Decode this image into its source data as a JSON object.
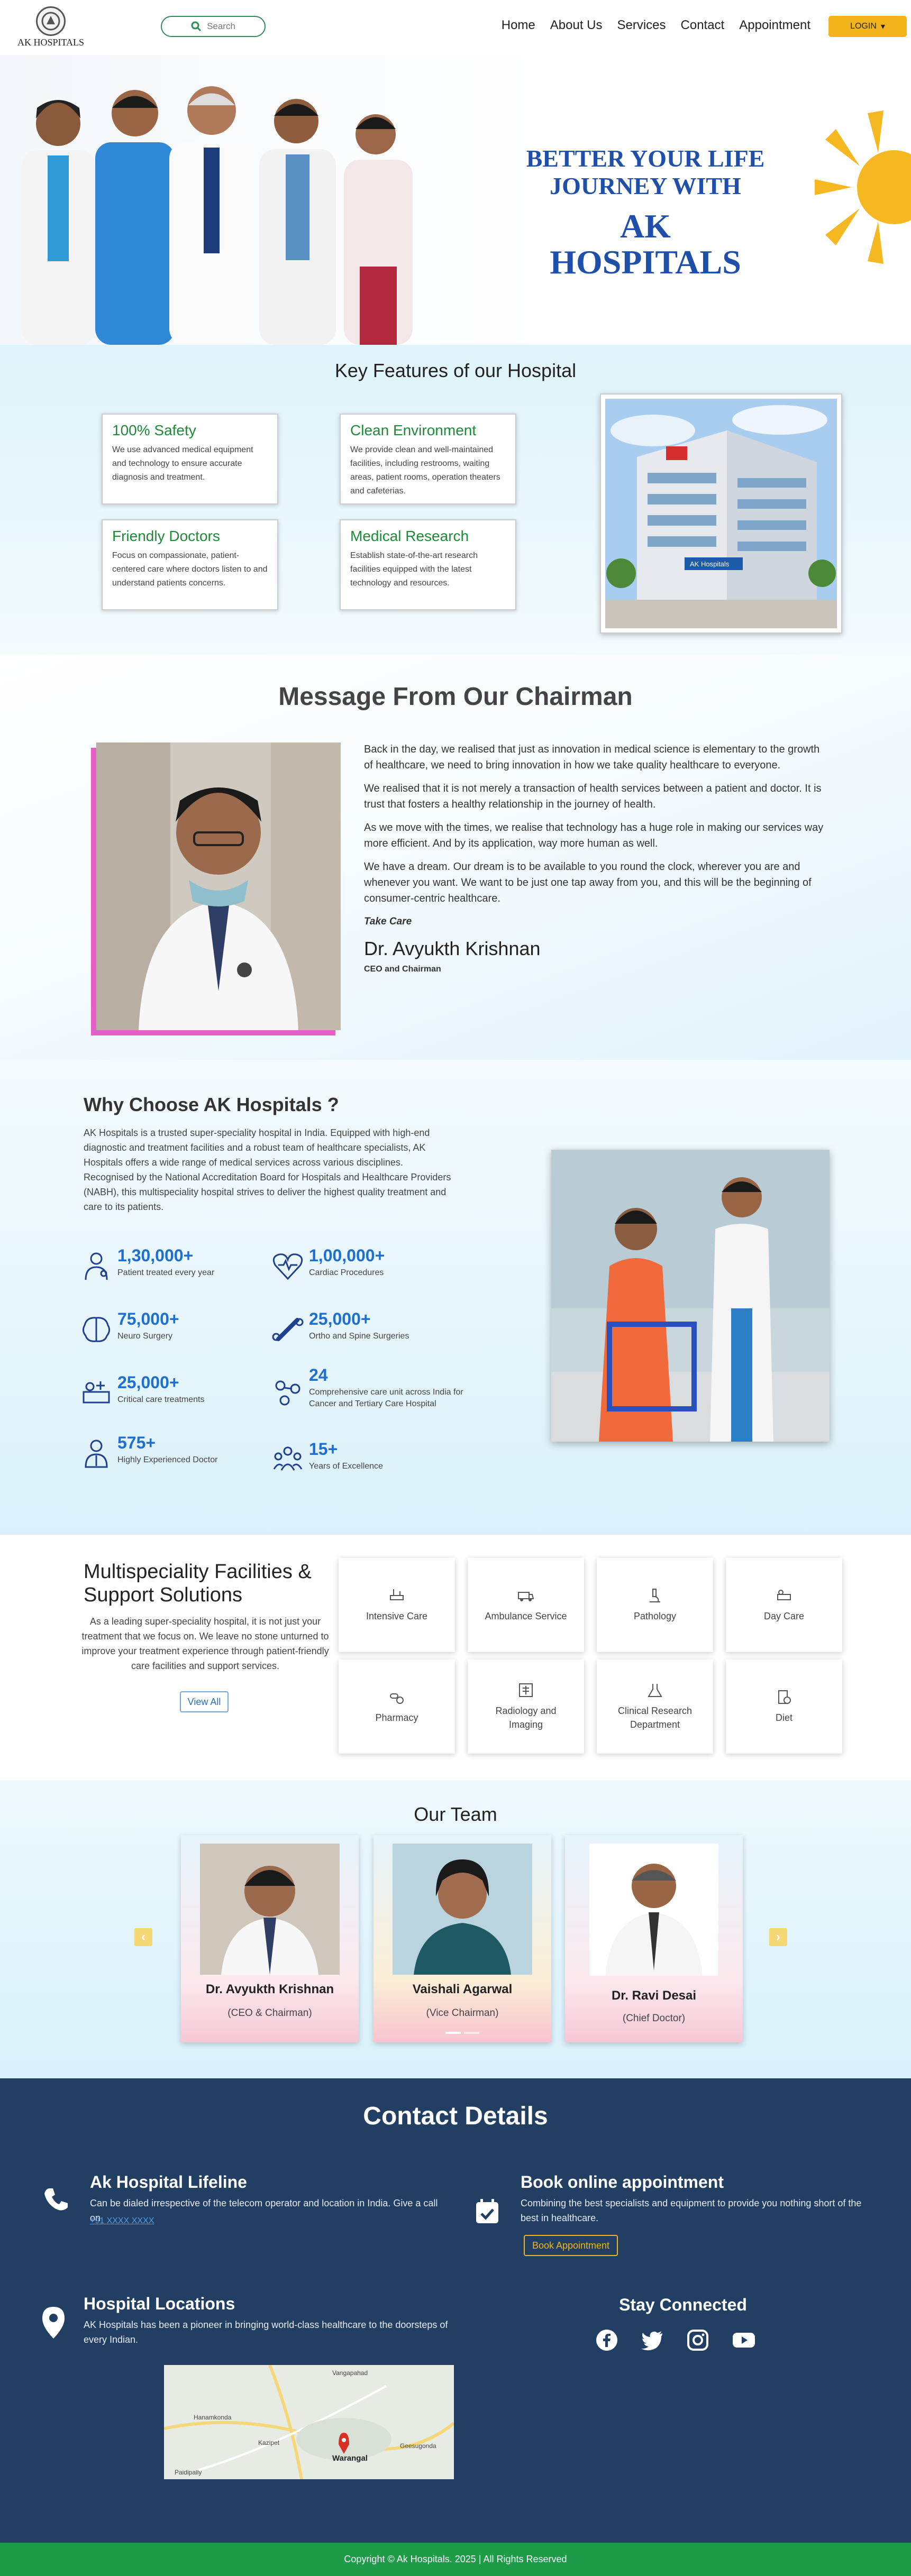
{
  "nav": {
    "logo_text": "AK HOSPITALS",
    "search_placeholder": "Search",
    "menu": [
      "Home",
      "About Us",
      "Services",
      "Contact",
      "Appointment"
    ],
    "login_label": "LOGIN"
  },
  "hero": {
    "line1": "BETTER YOUR LIFE",
    "line2": "JOURNEY WITH",
    "line3": "AK",
    "line4": "HOSPITALS"
  },
  "features": {
    "title": "Key Features of our Hospital",
    "cards": [
      {
        "title": "100% Safety",
        "text": "We use advanced medical equipment and technology to ensure accurate diagnosis and treatment."
      },
      {
        "title": "Clean Environment",
        "text": "We provide clean and well-maintained facilities, including restrooms, waiting areas, patient rooms, operation theaters and cafeterias."
      },
      {
        "title": "Friendly Doctors",
        "text": "Focus on compassionate, patient-centered care where doctors listen to and understand patients concerns."
      },
      {
        "title": "Medical Research",
        "text": "Establish state-of-the-art research facilities equipped with the latest technology and resources."
      }
    ],
    "building_sign": "AK Hospitals"
  },
  "chairman": {
    "title": "Message From Our Chairman",
    "paragraphs": [
      "Back in the day, we realised that just as innovation in medical science is elementary to the growth of healthcare, we need to bring innovation in how we take quality healthcare to everyone.",
      "We realised that it is not merely a transaction of health services between a patient and doctor. It is trust that fosters a healthy relationship in the journey of health.",
      "As we move with the times, we realise that technology has a huge role in making our services way more efficient. And by its application, way more human as well.",
      "We have a dream. Our dream is to be available to you round the clock, wherever you are and whenever you want. We want to be just one tap away from you, and this will be the beginning of consumer-centric healthcare."
    ],
    "signoff": "Take Care",
    "name": "Dr. Avyukth Krishnan",
    "role": "CEO and Chairman"
  },
  "why": {
    "title": "Why Choose AK Hospitals ?",
    "paragraph": "AK Hospitals is a trusted super-speciality hospital in India. Equipped with high-end diagnostic and treatment facilities and a robust team of healthcare specialists, AK Hospitals offers a wide range of medical services across various disciplines. Recognised by the National Accreditation Board for Hospitals and Healthcare Providers (NABH), this multispeciality hospital strives to deliver the highest quality treatment and care to its patients.",
    "stats": [
      {
        "num": "1,30,000+",
        "label": "Patient treated every year",
        "icon": "patient-icon"
      },
      {
        "num": "1,00,000+",
        "label": "Cardiac Procedures",
        "icon": "heart-icon"
      },
      {
        "num": "75,000+",
        "label": "Neuro Surgery",
        "icon": "brain-icon"
      },
      {
        "num": "25,000+",
        "label": "Ortho and Spine Surgeries",
        "icon": "bone-icon"
      },
      {
        "num": "25,000+",
        "label": "Critical care treatments",
        "icon": "critical-care-icon"
      },
      {
        "num": "24",
        "label": "Comprehensive care unit across India for Cancer and Tertiary Care Hospital",
        "icon": "care-unit-icon"
      },
      {
        "num": "575+",
        "label": "Highly Experienced Doctor",
        "icon": "doctor-icon"
      },
      {
        "num": "15+",
        "label": "Years of Excellence",
        "icon": "team-icon"
      }
    ]
  },
  "facilities": {
    "title": "Multispeciality Facilities & Support Solutions",
    "paragraph": "As a leading super-speciality hospital, it is not just your treatment that we focus on. We leave no stone unturned to improve your treatment experience through patient-friendly care facilities and support services.",
    "view_all": "View All",
    "tiles": [
      "Intensive Care",
      "Ambulance Service",
      "Pathology",
      "Day Care",
      "Pharmacy",
      "Radiology and Imaging",
      "Clinical Research Department",
      "Diet"
    ]
  },
  "team": {
    "title": "Our Team",
    "members": [
      {
        "name": "Dr. Avyukth Krishnan",
        "role": "(CEO & Chairman)"
      },
      {
        "name": "Vaishali Agarwal",
        "role": "(Vice Chairman)"
      },
      {
        "name": "Dr. Ravi Desai",
        "role": "(Chief Doctor)"
      }
    ]
  },
  "contact": {
    "title": "Contact Details",
    "lifeline_title": "Ak Hospital Lifeline",
    "lifeline_text": "Can be dialed irrespective of the telecom operator and location in India. Give a call on",
    "lifeline_phone": "+91 XXXX XXXX",
    "book_title": "Book online appointment",
    "book_text": "Combining the best specialists and equipment to provide you nothing short of the best in healthcare.",
    "book_button": "Book Appointment",
    "locations_title": "Hospital Locations",
    "locations_text": "AK Hospitals has been a pioneer in bringing world-class healthcare to the doorsteps of every Indian.",
    "map_labels": [
      "Warangal",
      "Hanamkonda",
      "Kazipet",
      "Geesugonda",
      "Vangapahad",
      "Paidipally"
    ],
    "stay_title": "Stay Connected",
    "socials": [
      "facebook-icon",
      "twitter-icon",
      "instagram-icon",
      "youtube-icon"
    ]
  },
  "footer": {
    "text": "Copyright © Ak Hospitals. 2025 | All Rights Reserved"
  },
  "colors": {
    "accent": "#f2b31b",
    "green": "#1e9b48",
    "navy": "#223f63",
    "blue": "#1d6fd1",
    "feature_green": "#1e8a3a"
  }
}
